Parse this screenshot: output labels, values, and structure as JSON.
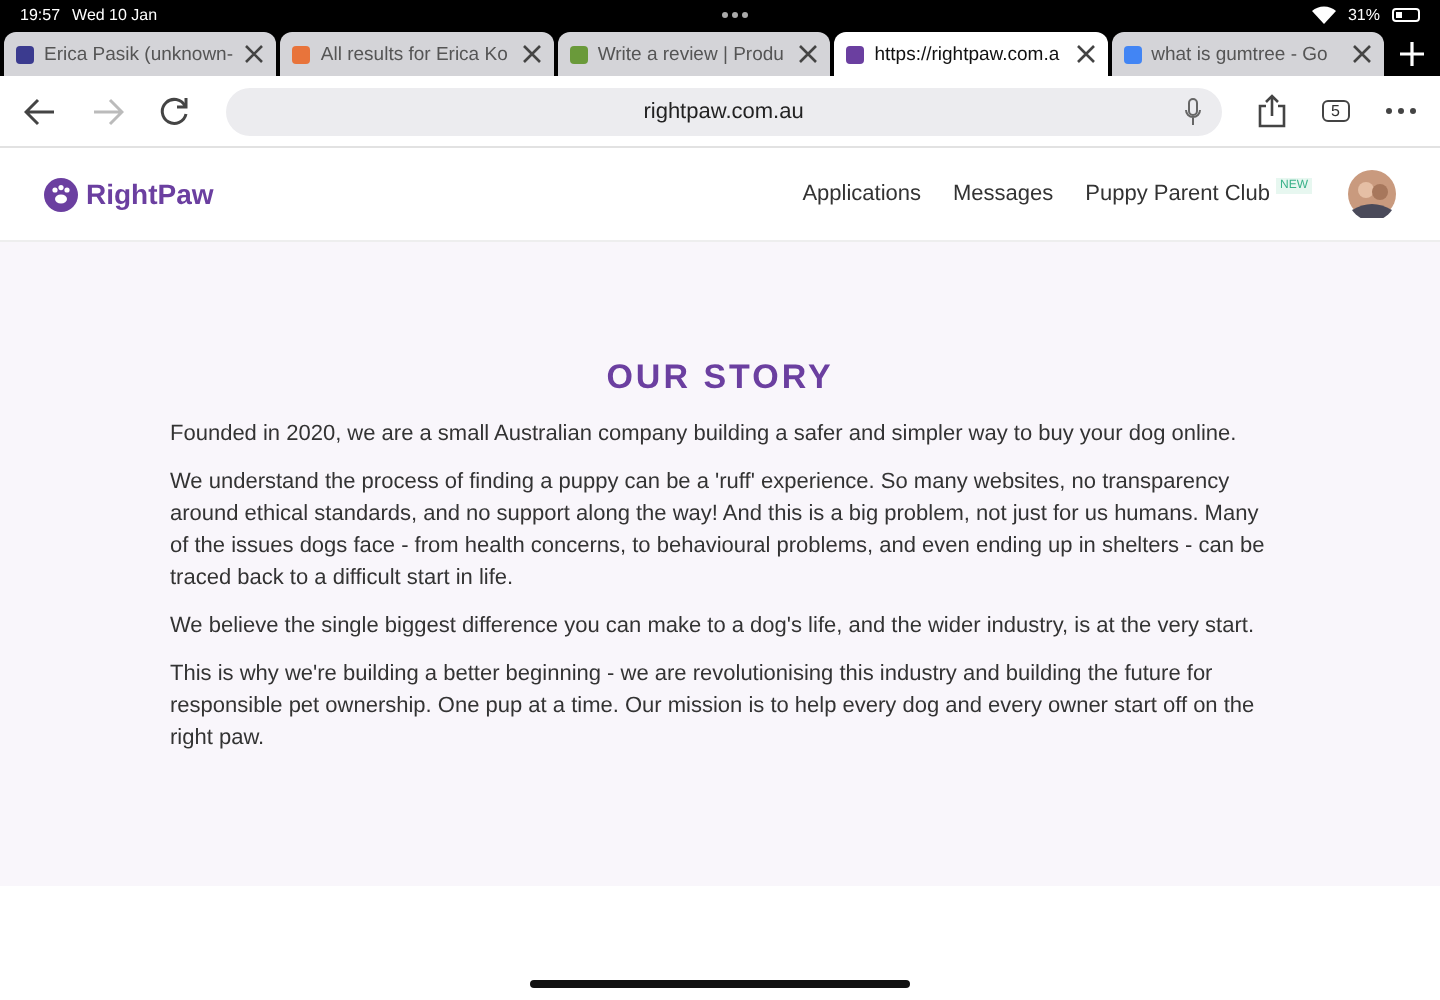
{
  "status_bar": {
    "time": "19:57",
    "date": "Wed 10 Jan",
    "battery": "31%"
  },
  "tabs": [
    {
      "title": "Erica Pasik (unknown-",
      "color": "#3b3b8f",
      "selected": false
    },
    {
      "title": "All results for Erica Ko",
      "color": "#e8743b",
      "selected": false
    },
    {
      "title": "Write a review | Produ",
      "color": "#6a9a3a",
      "selected": false
    },
    {
      "title": "https://rightpaw.com.a",
      "color": "#6b3fa0",
      "selected": true
    },
    {
      "title": "what is gumtree - Go",
      "color": "#4285f4",
      "selected": false
    }
  ],
  "toolbar": {
    "address": "rightpaw.com.au",
    "tab_count": "5"
  },
  "site": {
    "logo": "RightPaw",
    "nav": [
      {
        "label": "Applications"
      },
      {
        "label": "Messages"
      },
      {
        "label": "Puppy Parent Club",
        "badge": "NEW"
      }
    ]
  },
  "story": {
    "heading": "OUR STORY",
    "paragraphs": [
      "Founded in 2020, we are a small Australian company building a safer and simpler way to buy your dog online.",
      "We understand the process of finding a puppy can be a 'ruff' experience. So many websites, no transparency around ethical standards, and no support along the way! And this is a big problem, not just for us humans. Many of the issues dogs face - from health concerns, to behavioural problems, and even ending up in shelters - can be traced back to a difficult start in life.",
      "We believe the single biggest difference you can make to a dog's life, and the wider industry, is at the very start.",
      "This is why we're building a better beginning - we are revolutionising this industry and building the future for responsible pet ownership. One pup at a time. Our mission is to help every dog and every owner start off on the right paw."
    ]
  }
}
